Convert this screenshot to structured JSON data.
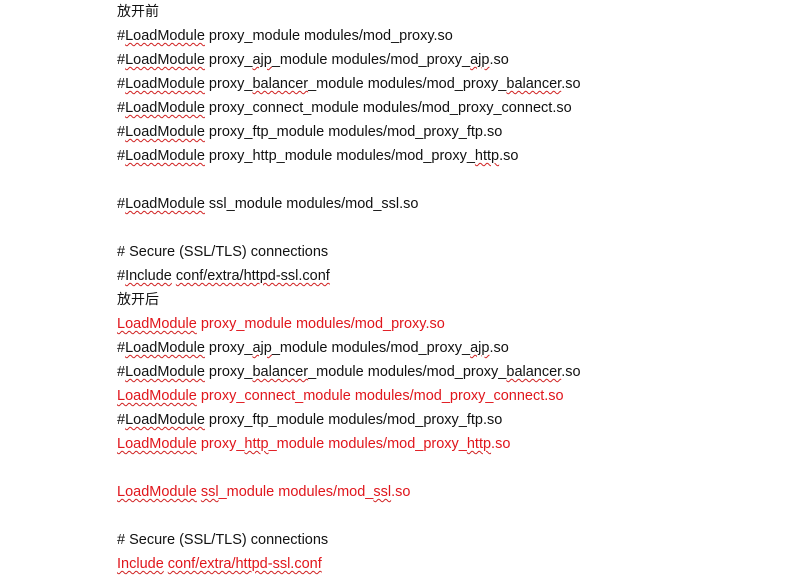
{
  "document": {
    "before": {
      "heading": "放开前",
      "lines": [
        {
          "prefix": "#",
          "kw": "LoadModule",
          "a": " proxy_module modules/mod_proxy",
          "b": ".so"
        },
        {
          "prefix": "#",
          "kw": "LoadModule",
          "a": " proxy_",
          "w1": "ajp",
          "c": "_module modules/mod_proxy_",
          "w2": "ajp",
          "b": ".so"
        },
        {
          "prefix": "#",
          "kw": "LoadModule",
          "a": " proxy_",
          "w1": "balancer",
          "c": "_module modules/mod_proxy_",
          "w2": "balancer",
          "b": ".so"
        },
        {
          "prefix": "#",
          "kw": "LoadModule",
          "a": " proxy_connect_module modules/mod_proxy_connect",
          "b": ".so"
        },
        {
          "prefix": "#",
          "kw": "LoadModule",
          "a": " proxy_ftp_module modules/mod_proxy_ftp",
          "b": ".so"
        },
        {
          "prefix": "#",
          "kw": "LoadModule",
          "a": " proxy_http_module modules/mod_proxy_",
          "w2": "http",
          "b": ".so"
        }
      ],
      "ssl_line": {
        "prefix": "#",
        "kw": "LoadModule",
        "a": " ssl_module modules/mod_ssl",
        "b": ".so"
      },
      "comment": "# Secure (SSL/TLS) connections",
      "include": {
        "prefix": "#",
        "kw": "Include",
        "a": " ",
        "w1": "conf/extra/httpd-ssl.conf"
      }
    },
    "after": {
      "heading": "放开后",
      "lines": [
        {
          "prefix": "",
          "kw": "LoadModule",
          "a": " proxy_module modules/mod_proxy",
          "b": ".so",
          "red": true
        },
        {
          "prefix": "#",
          "kw": "LoadModule",
          "a": " proxy_",
          "w1": "ajp",
          "c": "_module modules/mod_proxy_",
          "w2": "ajp",
          "b": ".so",
          "red": false
        },
        {
          "prefix": "#",
          "kw": "LoadModule",
          "a": " proxy_",
          "w1": "balancer",
          "c": "_module modules/mod_proxy_",
          "w2": "balancer",
          "b": ".so",
          "red": false
        },
        {
          "prefix": "",
          "kw": "LoadModule",
          "a": " proxy_connect_module modules/mod_proxy_connect",
          "b": ".so",
          "red": true
        },
        {
          "prefix": "#",
          "kw": "LoadModule",
          "a": " proxy_ftp_module modules/mod_proxy_ftp",
          "b": ".so",
          "red": false
        },
        {
          "prefix": "",
          "kw": "LoadModule",
          "a": " proxy_",
          "w1": "http",
          "c": "_module modules/mod_proxy_",
          "w2": "http",
          "b": ".so",
          "red": true
        }
      ],
      "ssl_line": {
        "prefix": "",
        "kw": "LoadModule",
        "a": " ",
        "w1": "ssl",
        "c": "_module modules/mod_",
        "w2": "ssl",
        "b": ".so",
        "red": true
      },
      "comment": "# Secure (SSL/TLS) connections",
      "include": {
        "prefix": "",
        "kw": "Include",
        "a": " ",
        "w1": "conf/extra/httpd-ssl.conf",
        "red": true
      }
    },
    "colors": {
      "text": "#111111",
      "highlight": "#e0161c",
      "squiggle": "#d02020"
    }
  }
}
